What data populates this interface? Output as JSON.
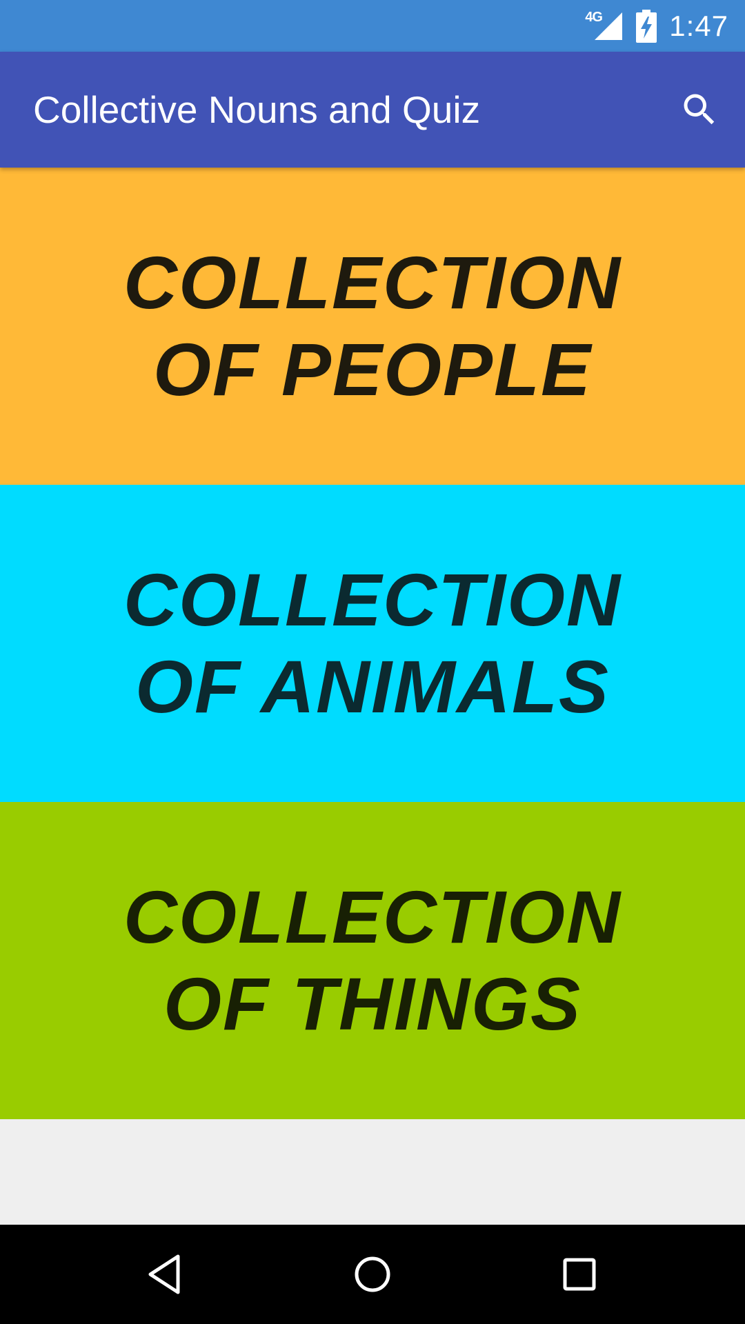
{
  "status_bar": {
    "network": "4G",
    "time": "1:47",
    "icons": [
      "signal-icon",
      "battery-charging-icon"
    ]
  },
  "app_bar": {
    "title": "Collective Nouns and Quiz",
    "search_icon": "search-icon"
  },
  "categories": [
    {
      "label": "COLLECTION OF PEOPLE",
      "background": "#FFB937",
      "text_color": "#1E1A0E"
    },
    {
      "label": "COLLECTION OF ANIMALS",
      "background": "#00DCFF",
      "text_color": "#0B2A30"
    },
    {
      "label": "COLLECTION OF THINGS",
      "background": "#99CC00",
      "text_color": "#182004"
    }
  ],
  "nav_bar": {
    "icons": [
      "back-icon",
      "home-icon",
      "recents-icon"
    ]
  },
  "colors": {
    "status_bar": "#3F88D2",
    "app_bar": "#4153B6",
    "content_background": "#EFEFEF",
    "nav_bar": "#000000"
  }
}
